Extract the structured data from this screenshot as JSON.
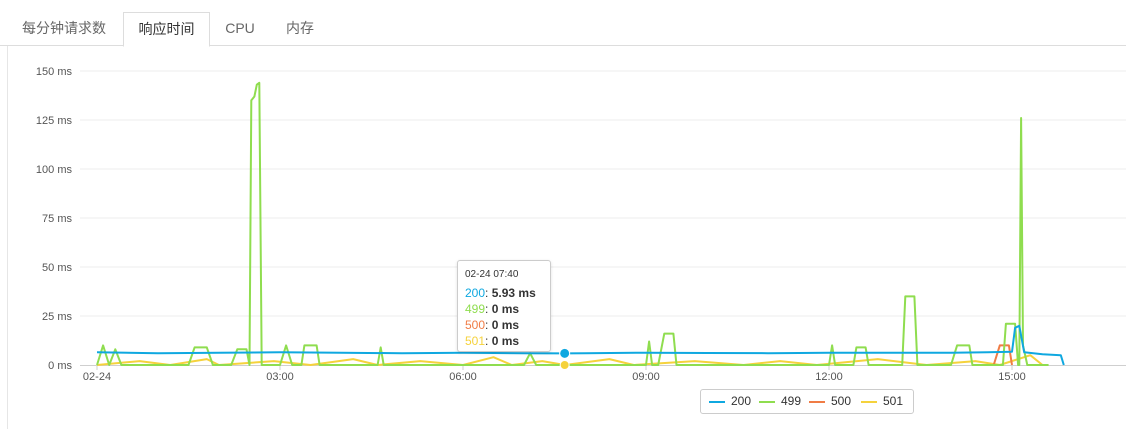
{
  "tabs": [
    {
      "label": "每分钟请求数",
      "active": false
    },
    {
      "label": "响应时间",
      "active": true
    },
    {
      "label": "CPU",
      "active": false
    },
    {
      "label": "内存",
      "active": false
    }
  ],
  "chart_data": {
    "type": "line",
    "title": "",
    "xlabel": "",
    "ylabel": "",
    "ylim": [
      0,
      150
    ],
    "yticks": [
      "0 ms",
      "25 ms",
      "50 ms",
      "75 ms",
      "100 ms",
      "125 ms",
      "150 ms"
    ],
    "xticks": [
      "02-24",
      "03:00",
      "06:00",
      "09:00",
      "12:00",
      "15:00"
    ],
    "x_unit": "hours since 02-24 00:00",
    "xlim": [
      -0.3,
      17.3
    ],
    "grid": true,
    "legend_position": "bottom-center",
    "series": [
      {
        "name": "200",
        "color": "#0fa8e0",
        "points": [
          [
            0,
            6.5
          ],
          [
            1,
            6
          ],
          [
            2,
            6.3
          ],
          [
            3,
            6.5
          ],
          [
            4,
            6.2
          ],
          [
            5,
            6
          ],
          [
            6,
            6.3
          ],
          [
            7,
            6
          ],
          [
            7.67,
            5.93
          ],
          [
            8,
            6
          ],
          [
            9,
            6.3
          ],
          [
            10,
            6.1
          ],
          [
            11,
            6
          ],
          [
            12,
            6.2
          ],
          [
            13,
            6.2
          ],
          [
            14,
            6.3
          ],
          [
            14.6,
            6.5
          ],
          [
            15,
            6.8
          ],
          [
            15.05,
            19
          ],
          [
            15.12,
            20
          ],
          [
            15.2,
            6.5
          ],
          [
            15.5,
            5.5
          ],
          [
            15.8,
            5
          ],
          [
            15.85,
            0
          ]
        ]
      },
      {
        "name": "499",
        "color": "#8fdd4f",
        "points": [
          [
            0,
            0
          ],
          [
            0.1,
            10
          ],
          [
            0.2,
            0
          ],
          [
            0.3,
            8
          ],
          [
            0.4,
            0
          ],
          [
            1.5,
            0
          ],
          [
            1.6,
            9
          ],
          [
            1.8,
            9
          ],
          [
            1.9,
            0
          ],
          [
            2.2,
            0
          ],
          [
            2.3,
            8
          ],
          [
            2.45,
            8
          ],
          [
            2.5,
            0
          ],
          [
            2.53,
            135
          ],
          [
            2.58,
            137
          ],
          [
            2.62,
            143
          ],
          [
            2.66,
            144
          ],
          [
            2.7,
            0
          ],
          [
            3,
            0
          ],
          [
            3.1,
            10
          ],
          [
            3.2,
            0
          ],
          [
            3.35,
            0
          ],
          [
            3.4,
            10
          ],
          [
            3.6,
            10
          ],
          [
            3.65,
            0
          ],
          [
            4.6,
            0
          ],
          [
            4.65,
            9
          ],
          [
            4.7,
            0
          ],
          [
            7,
            0
          ],
          [
            7.1,
            6
          ],
          [
            7.2,
            0
          ],
          [
            9,
            0
          ],
          [
            9.05,
            12
          ],
          [
            9.1,
            0
          ],
          [
            9.2,
            0
          ],
          [
            9.3,
            16
          ],
          [
            9.45,
            16
          ],
          [
            9.5,
            0
          ],
          [
            12,
            0
          ],
          [
            12.05,
            10
          ],
          [
            12.1,
            0
          ],
          [
            12.4,
            0
          ],
          [
            12.45,
            9
          ],
          [
            12.6,
            9
          ],
          [
            12.65,
            0
          ],
          [
            13.2,
            0
          ],
          [
            13.25,
            35
          ],
          [
            13.4,
            35
          ],
          [
            13.45,
            0
          ],
          [
            14,
            0
          ],
          [
            14.1,
            10
          ],
          [
            14.3,
            10
          ],
          [
            14.35,
            0
          ],
          [
            14.85,
            0
          ],
          [
            14.9,
            21
          ],
          [
            15.05,
            21
          ],
          [
            15.1,
            0
          ],
          [
            15.12,
            0
          ],
          [
            15.15,
            126
          ],
          [
            15.18,
            10
          ],
          [
            15.25,
            0
          ],
          [
            15.6,
            0
          ]
        ]
      },
      {
        "name": "500",
        "color": "#f07c45",
        "points": [
          [
            14.7,
            0
          ],
          [
            14.8,
            10
          ],
          [
            14.95,
            10
          ],
          [
            15,
            0
          ]
        ]
      },
      {
        "name": "501",
        "color": "#f5d23c",
        "points": [
          [
            0,
            0
          ],
          [
            0.7,
            2
          ],
          [
            1.2,
            0
          ],
          [
            1.8,
            3
          ],
          [
            2.0,
            0
          ],
          [
            2.9,
            2
          ],
          [
            3.5,
            0
          ],
          [
            4.2,
            3
          ],
          [
            4.6,
            0
          ],
          [
            5.3,
            2
          ],
          [
            6.0,
            0
          ],
          [
            6.5,
            4
          ],
          [
            6.8,
            0
          ],
          [
            7.3,
            2
          ],
          [
            7.67,
            0
          ],
          [
            8.4,
            3
          ],
          [
            8.8,
            0
          ],
          [
            9.8,
            2
          ],
          [
            10.6,
            0
          ],
          [
            11.2,
            2
          ],
          [
            11.8,
            0
          ],
          [
            12.8,
            3
          ],
          [
            13.6,
            0
          ],
          [
            14.4,
            2
          ],
          [
            14.8,
            0
          ],
          [
            15.3,
            5
          ],
          [
            15.5,
            0
          ]
        ]
      }
    ]
  },
  "tooltip": {
    "time": "02-24 07:40",
    "rows": [
      {
        "name": "200",
        "value": "5.93 ms",
        "color": "#0fa8e0"
      },
      {
        "name": "499",
        "value": "0 ms",
        "color": "#8fdd4f"
      },
      {
        "name": "500",
        "value": "0 ms",
        "color": "#f07c45"
      },
      {
        "name": "501",
        "value": "0 ms",
        "color": "#f5d23c"
      }
    ]
  },
  "legend": [
    {
      "name": "200",
      "color": "#0fa8e0"
    },
    {
      "name": "499",
      "color": "#8fdd4f"
    },
    {
      "name": "500",
      "color": "#f07c45"
    },
    {
      "name": "501",
      "color": "#f5d23c"
    }
  ]
}
